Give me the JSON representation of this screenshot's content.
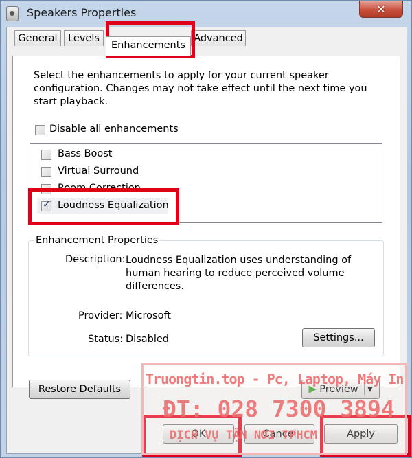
{
  "window": {
    "title": "Speakers Properties",
    "close_glyph": "✕"
  },
  "tabs": [
    {
      "label": "General",
      "active": false
    },
    {
      "label": "Levels",
      "active": false
    },
    {
      "label": "Enhancements",
      "active": true
    },
    {
      "label": "Advanced",
      "active": false
    }
  ],
  "enhancements": {
    "intro": "Select the enhancements to apply for your current speaker configuration. Changes may not take effect until the next time you start playback.",
    "disable_all_label": "Disable all enhancements",
    "disable_all_checked": false,
    "items": [
      {
        "label": "Bass Boost",
        "checked": false
      },
      {
        "label": "Virtual Surround",
        "checked": false
      },
      {
        "label": "Room Correction",
        "checked": false
      },
      {
        "label": "Loudness Equalization",
        "checked": true
      }
    ]
  },
  "properties": {
    "legend": "Enhancement Properties",
    "description_label": "Description:",
    "description_value": "Loudness Equalization uses understanding of human hearing to reduce perceived volume differences.",
    "provider_label": "Provider:",
    "provider_value": "Microsoft",
    "status_label": "Status:",
    "status_value": "Disabled",
    "settings_button": "Settings..."
  },
  "buttons": {
    "restore_defaults": "Restore Defaults",
    "preview": "Preview",
    "ok": "OK",
    "cancel": "Cancel",
    "apply": "Apply"
  },
  "watermark": {
    "line1": "Truongtin.top - Pc, Laptop, Máy In",
    "line2": "ĐT: 028 7300 3894",
    "line3": "DỊCH VỤ TẬN NƠI TPHCM"
  },
  "colors": {
    "highlight": "#e0001a",
    "watermark": "#ec6f6f",
    "close_button": "#c7513d"
  }
}
